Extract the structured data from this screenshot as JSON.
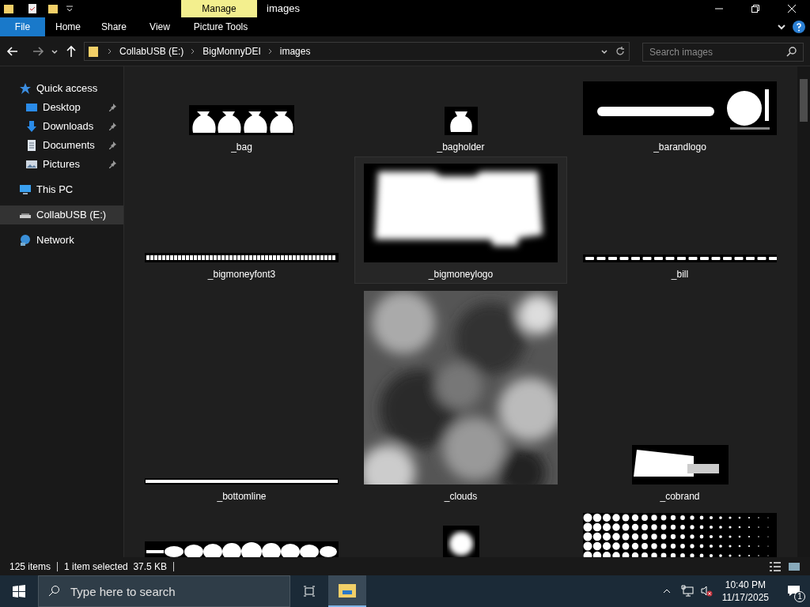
{
  "window": {
    "title": "images",
    "context_tab": "Manage"
  },
  "ribbon_tabs": [
    {
      "label": "File",
      "kind": "file"
    },
    {
      "label": "Home",
      "kind": "tab"
    },
    {
      "label": "Share",
      "kind": "tab"
    },
    {
      "label": "View",
      "kind": "tab"
    },
    {
      "label": "Picture Tools",
      "kind": "context"
    }
  ],
  "breadcrumb": [
    "CollabUSB (E:)",
    "BigMonnyDEI",
    "images"
  ],
  "search": {
    "placeholder": "Search images"
  },
  "sidebar": {
    "items": [
      {
        "label": "Quick access",
        "kind": "star",
        "selected": false,
        "children": [
          {
            "label": "Desktop",
            "kind": "desktop",
            "pinned": true,
            "selected": false
          },
          {
            "label": "Downloads",
            "kind": "download",
            "pinned": true,
            "selected": false
          },
          {
            "label": "Documents",
            "kind": "document",
            "pinned": true,
            "selected": false
          },
          {
            "label": "Pictures",
            "kind": "pictures",
            "pinned": true,
            "selected": false
          }
        ]
      },
      {
        "label": "This PC",
        "kind": "pc",
        "selected": false
      },
      {
        "label": "CollabUSB (E:)",
        "kind": "drive",
        "selected": true
      },
      {
        "label": "Network",
        "kind": "network",
        "selected": false
      }
    ]
  },
  "files": [
    {
      "name": "_bag",
      "kind": "bags",
      "selected": false
    },
    {
      "name": "_bagholder",
      "kind": "bag",
      "selected": false
    },
    {
      "name": "_barandlogo",
      "kind": "barlogo",
      "selected": false
    },
    {
      "name": "_bigmoneyfont3",
      "kind": "font",
      "selected": false
    },
    {
      "name": "_bigmoneylogo",
      "kind": "blob",
      "selected": true
    },
    {
      "name": "_bill",
      "kind": "dashes",
      "selected": false
    },
    {
      "name": "_bottomline",
      "kind": "line",
      "selected": false
    },
    {
      "name": "_clouds",
      "kind": "clouds",
      "selected": false
    },
    {
      "name": "_cobrand",
      "kind": "cobrand",
      "selected": false
    },
    {
      "kind": "coinrow",
      "selected": false
    },
    {
      "kind": "glow",
      "selected": false
    },
    {
      "kind": "dots",
      "selected": false
    }
  ],
  "status_bar": {
    "count": "125 items",
    "selection": "1 item selected  37.5 KB"
  },
  "taskbar": {
    "search_placeholder": "Type here to search",
    "time": "10:40 PM",
    "date": "11/17/2025",
    "notifications": "1"
  }
}
